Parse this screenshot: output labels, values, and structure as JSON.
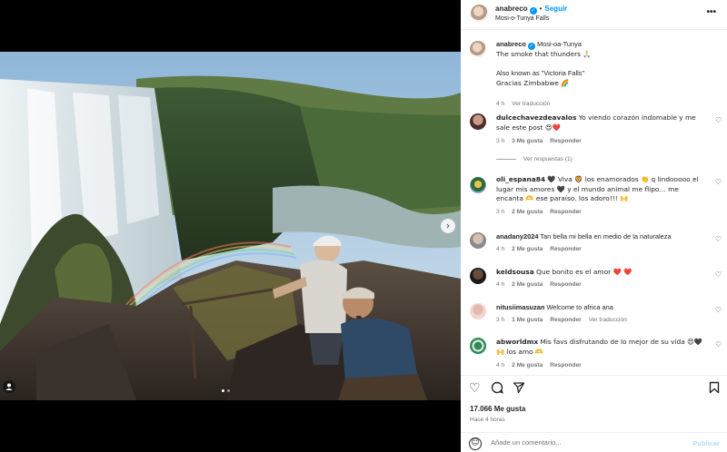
{
  "post": {
    "username": "anabreco",
    "separator": "•",
    "follow_label": "Seguir",
    "location": "Mosi-o-Tunya Falls",
    "more_icon": "more-horizontal-icon"
  },
  "caption": {
    "username": "anabreco",
    "location": "Mosi-oa-Tunya",
    "line1": "The smoke that thunders 🙏🏻",
    "line2": "Also known as \"Victoria Falls\"",
    "line3": "Gracias Zimbabwe 🌈",
    "time": "4 h",
    "translate": "Ver traducción"
  },
  "comments": [
    {
      "username": "dulcechavezdeavalos",
      "text": "Yo viendo corazón indomable y me sale este post 😍❤️",
      "time": "3 h",
      "likes": "3 Me gusta",
      "reply": "Responder",
      "replies": "Ver respuestas (1)"
    },
    {
      "username": "oli_espana84",
      "text": "🖤 Viva 🦁 los enamorados 👏 q lindooooo el lugar mis amores 🖤 y el mundo animal me flipo… me encanta 🫶 ese paraíso. los adoro!!! 🙌",
      "time": "3 h",
      "likes": "2 Me gusta",
      "reply": "Responder"
    },
    {
      "username": "anadany2024",
      "text": "Tan bella mi bella en medio de la naturaleza",
      "time": "4 h",
      "likes": "2 Me gusta",
      "reply": "Responder"
    },
    {
      "username": "keldsousa",
      "text": "Que bonito es el amor ❤️ ❤️",
      "time": "4 h",
      "likes": "2 Me gusta",
      "reply": "Responder"
    },
    {
      "username": "nitusiimasuzan",
      "text": "Welcome to africa ana",
      "time": "3 h",
      "likes": "1 Me gusta",
      "reply": "Responder",
      "translate": "Ver traducción"
    },
    {
      "username": "abworldmx",
      "text": "Mis favs disfrutando de lo mejor de su vida 😍🖤🙌 los amo 🫶",
      "time": "4 h",
      "likes": "2 Me gusta",
      "reply": "Responder"
    }
  ],
  "footer": {
    "likes": "17.066 Me gusta",
    "ago": "Hace 4 horas",
    "comment_placeholder": "Añade un comentario...",
    "publish": "Publicar"
  },
  "icons": {
    "like": "heart-outline-icon",
    "comment": "comment-icon",
    "share": "share-icon",
    "save": "bookmark-icon",
    "emoji": "emoji-icon",
    "next": "chevron-right-icon",
    "tag": "user-tag-icon"
  },
  "carousel": {
    "slide_count": 2,
    "current_index": 1
  },
  "colors": {
    "link_blue": "#0095f6",
    "verified_blue": "#0095f6",
    "muted": "#737373"
  }
}
